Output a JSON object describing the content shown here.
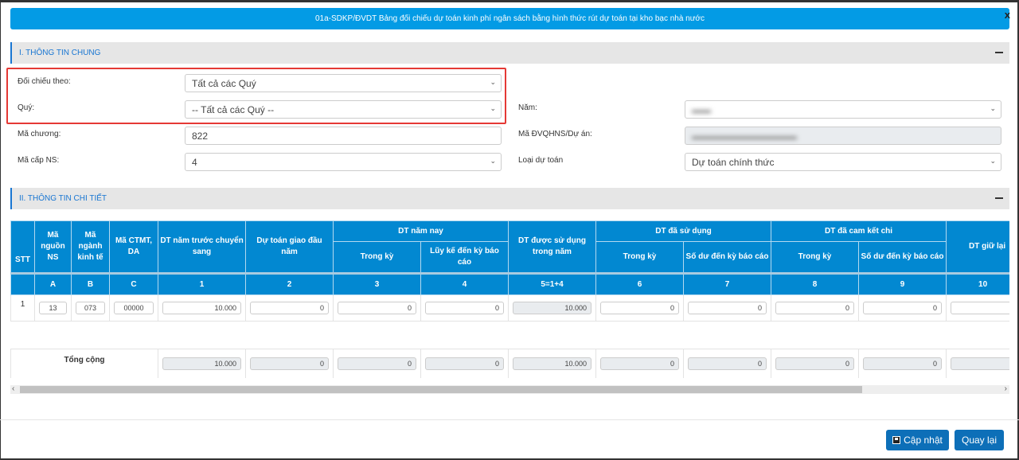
{
  "dialog": {
    "title": "01a-SDKP/ĐVDT Bảng đối chiếu dự toán kinh phí ngân sách bằng hình thức rút dự toán tại kho bạc nhà nước",
    "close": "x"
  },
  "section1": {
    "title": "I. THÔNG TIN CHUNG",
    "doi_chieu_label": "Đối chiếu theo:",
    "doi_chieu_value": "Tất cả các Quý",
    "quy_label": "Quý:",
    "quy_value": "-- Tất cả các Quý --",
    "ma_chuong_label": "Mã chương:",
    "ma_chuong_value": "822",
    "ma_cap_label": "Mã cấp NS:",
    "ma_cap_value": "4",
    "nam_label": "Năm:",
    "dvqhns_label": "Mã ĐVQHNS/Dự án:",
    "loai_label": "Loại dự toán",
    "loai_value": "Dự toán chính thức"
  },
  "section2": {
    "title": "II. THÔNG TIN CHI TIẾT"
  },
  "table": {
    "h": {
      "stt": "STT",
      "nguon": "Mã nguồn NS",
      "nganh": "Mã ngành kinh tế",
      "ctmt": "Mã CTMT, DA",
      "c1": "DT năm trước chuyển sang",
      "c2": "Dự toán giao đầu năm",
      "namnay": "DT năm nay",
      "dasd": "DT được sử dụng trong năm",
      "dasudung": "DT đã sử dụng",
      "camket": "DT đã cam kết chi",
      "giulai": "DT giữ lại",
      "trongky": "Trong kỳ",
      "luyke": "Lũy kế đến kỳ báo cáo",
      "sodu": "Số dư đến kỳ báo cáo"
    },
    "nums": [
      "A",
      "B",
      "C",
      "1",
      "2",
      "3",
      "4",
      "5=1+4",
      "6",
      "7",
      "8",
      "9",
      "10"
    ],
    "row": {
      "stt": "1",
      "nguon": "13",
      "nganh": "073",
      "ctmt": "00000",
      "vals": [
        "10.000",
        "0",
        "0",
        "0",
        "10.000",
        "0",
        "0",
        "0",
        "0",
        ""
      ]
    },
    "total": {
      "label": "Tổng cộng",
      "vals": [
        "10.000",
        "0",
        "0",
        "0",
        "10.000",
        "0",
        "0",
        "0",
        "0",
        ""
      ]
    }
  },
  "buttons": {
    "update": "Cập nhật",
    "back": "Quay lại"
  }
}
